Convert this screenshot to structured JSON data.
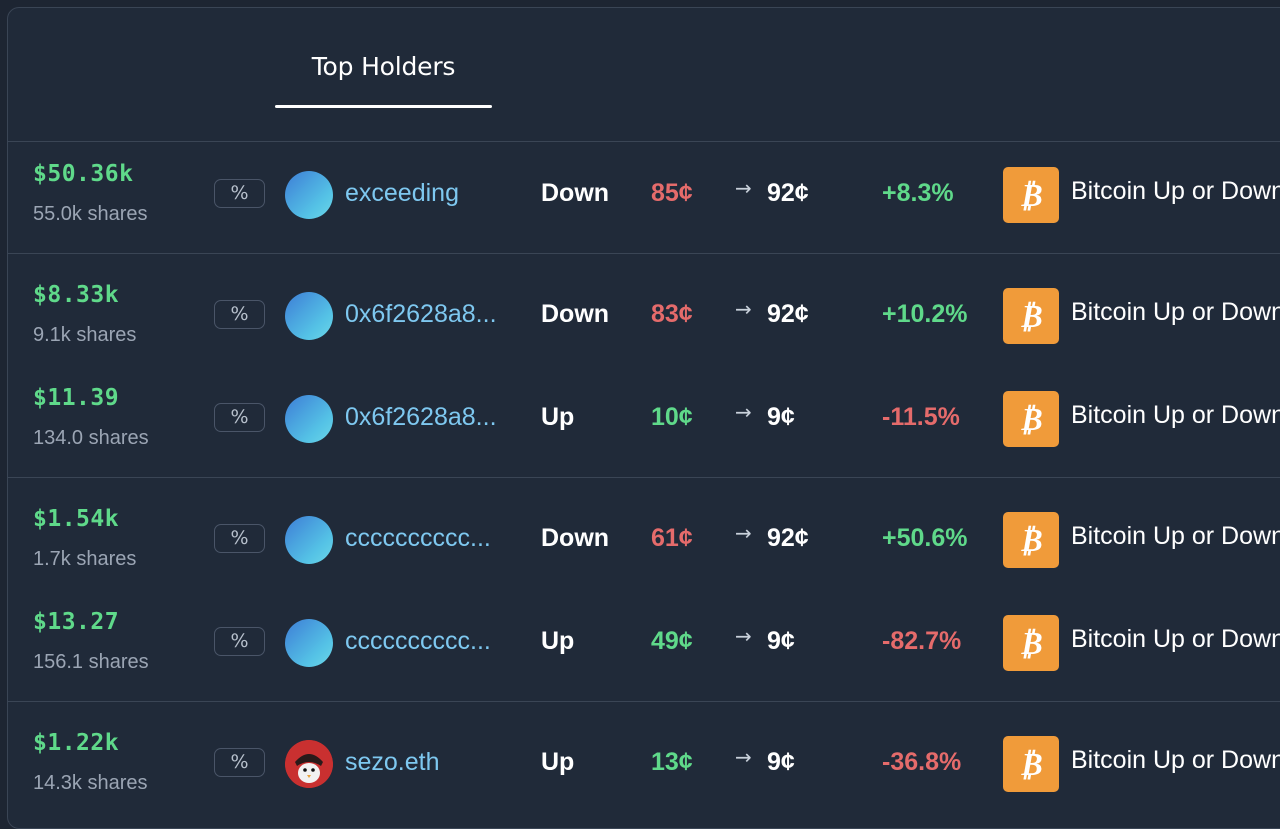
{
  "tabs": [
    {
      "label": "Top Holders"
    }
  ],
  "rows": [
    {
      "value": "$50.36k",
      "shares": "55.0k shares",
      "pct_label": "%",
      "user": "exceeding",
      "side": "Down",
      "entry": "85¢",
      "current": "92¢",
      "change": "+8.3%",
      "market": "Bitcoin Up or Down",
      "entry_color": "down",
      "change_color": "pos",
      "avatar": "gradient-avatar"
    },
    {
      "value": "$8.33k",
      "shares": "9.1k shares",
      "pct_label": "%",
      "user": "0x6f2628a8...",
      "side": "Down",
      "entry": "83¢",
      "current": "92¢",
      "change": "+10.2%",
      "market": "Bitcoin Up or Down",
      "entry_color": "down",
      "change_color": "pos",
      "avatar": "gradient-avatar"
    },
    {
      "value": "$11.39",
      "shares": "134.0 shares",
      "pct_label": "%",
      "user": "0x6f2628a8...",
      "side": "Up",
      "entry": "10¢",
      "current": "9¢",
      "change": "-11.5%",
      "market": "Bitcoin Up or Down",
      "entry_color": "up",
      "change_color": "neg",
      "avatar": "gradient-avatar"
    },
    {
      "value": "$1.54k",
      "shares": "1.7k shares",
      "pct_label": "%",
      "user": "cccccccccc...",
      "side": "Down",
      "entry": "61¢",
      "current": "92¢",
      "change": "+50.6%",
      "market": "Bitcoin Up or Down",
      "entry_color": "down",
      "change_color": "pos",
      "avatar": "gradient-avatar"
    },
    {
      "value": "$13.27",
      "shares": "156.1 shares",
      "pct_label": "%",
      "user": "cccccccccc...",
      "side": "Up",
      "entry": "49¢",
      "current": "9¢",
      "change": "-82.7%",
      "market": "Bitcoin Up or Down",
      "entry_color": "up",
      "change_color": "neg",
      "avatar": "gradient-avatar"
    },
    {
      "value": "$1.22k",
      "shares": "14.3k shares",
      "pct_label": "%",
      "user": "sezo.eth",
      "side": "Up",
      "entry": "13¢",
      "current": "9¢",
      "change": "-36.8%",
      "market": "Bitcoin Up or Down",
      "entry_color": "up",
      "change_color": "neg",
      "avatar": "profile-picture"
    }
  ],
  "icons": {
    "arrow": "→",
    "market_icon": "bitcoin-icon"
  },
  "colors": {
    "background": "#202a39",
    "positive": "#5fd98a",
    "negative": "#e56b6b",
    "username": "#7ec8f0",
    "bitcoin": "#f09b3a"
  }
}
